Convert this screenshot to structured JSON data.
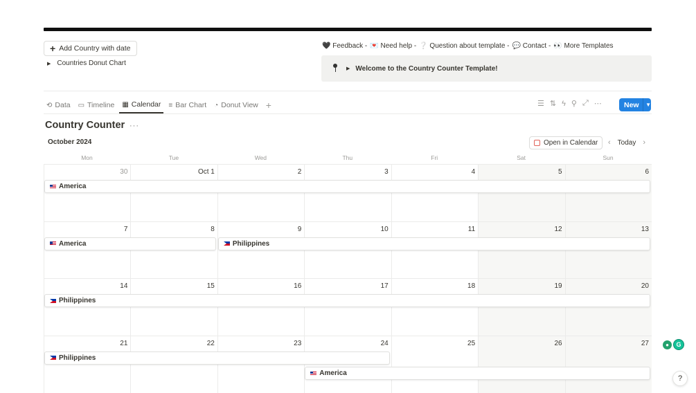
{
  "breadcrumb": "",
  "header": {
    "add_country_label": "Add Country with date",
    "toggle_label": "Countries Donut Chart",
    "links": [
      "🖤 Feedback -",
      "💌 Need help -",
      "❔ Question about template -",
      "💬 Contact -",
      "👀 More Templates"
    ],
    "callout_text": "Welcome to the Country Counter Template!"
  },
  "tabs": [
    {
      "label": "Data",
      "icon": "history-icon",
      "glyph": "⟲"
    },
    {
      "label": "Timeline",
      "icon": "timeline-icon",
      "glyph": "▭"
    },
    {
      "label": "Calendar",
      "icon": "calendar-icon",
      "glyph": "▦"
    },
    {
      "label": "Bar Chart",
      "icon": "bar-chart-icon",
      "glyph": "≡"
    },
    {
      "label": "Donut View",
      "icon": "donut-icon",
      "glyph": "◔"
    }
  ],
  "active_tab": 2,
  "toolbar": {
    "icons": [
      "filter-icon",
      "sort-icon",
      "automation-icon",
      "search-icon",
      "expand-icon",
      "more-icon"
    ],
    "glyphs": [
      "☰",
      "⇅",
      "ϟ",
      "⚲",
      "⤢",
      "⋯"
    ],
    "new_label": "New"
  },
  "database": {
    "title": "Country Counter",
    "more": "···"
  },
  "calendar": {
    "month_label": "October 2024",
    "open_in_calendar": "Open in Calendar",
    "today": "Today",
    "weekdays": [
      "Mon",
      "Tue",
      "Wed",
      "Thu",
      "Fri",
      "Sat",
      "Sun"
    ],
    "weeks": [
      [
        "30",
        "Oct 1",
        "2",
        "3",
        "4",
        "5",
        "6"
      ],
      [
        "7",
        "8",
        "9",
        "10",
        "11",
        "12",
        "13"
      ],
      [
        "14",
        "15",
        "16",
        "17",
        "18",
        "19",
        "20"
      ],
      [
        "21",
        "22",
        "23",
        "24",
        "25",
        "26",
        "27"
      ]
    ],
    "events": [
      {
        "label": "America",
        "flag": "us",
        "week": 0,
        "start": 0,
        "end": 6,
        "lane": 0
      },
      {
        "label": "America",
        "flag": "us",
        "week": 1,
        "start": 0,
        "end": 1,
        "lane": 0
      },
      {
        "label": "Philippines",
        "flag": "ph",
        "week": 1,
        "start": 2,
        "end": 6,
        "lane": 0
      },
      {
        "label": "Philippines",
        "flag": "ph",
        "week": 2,
        "start": 0,
        "end": 6,
        "lane": 0
      },
      {
        "label": "Philippines",
        "flag": "ph",
        "week": 3,
        "start": 0,
        "end": 3,
        "lane": 0
      },
      {
        "label": "America",
        "flag": "us",
        "week": 3,
        "start": 3,
        "end": 6,
        "lane": 1
      }
    ]
  },
  "colors": {
    "accent": "#2383e2",
    "weekend_bg": "#f7f7f5",
    "callout_bg": "#f1f1ef"
  }
}
